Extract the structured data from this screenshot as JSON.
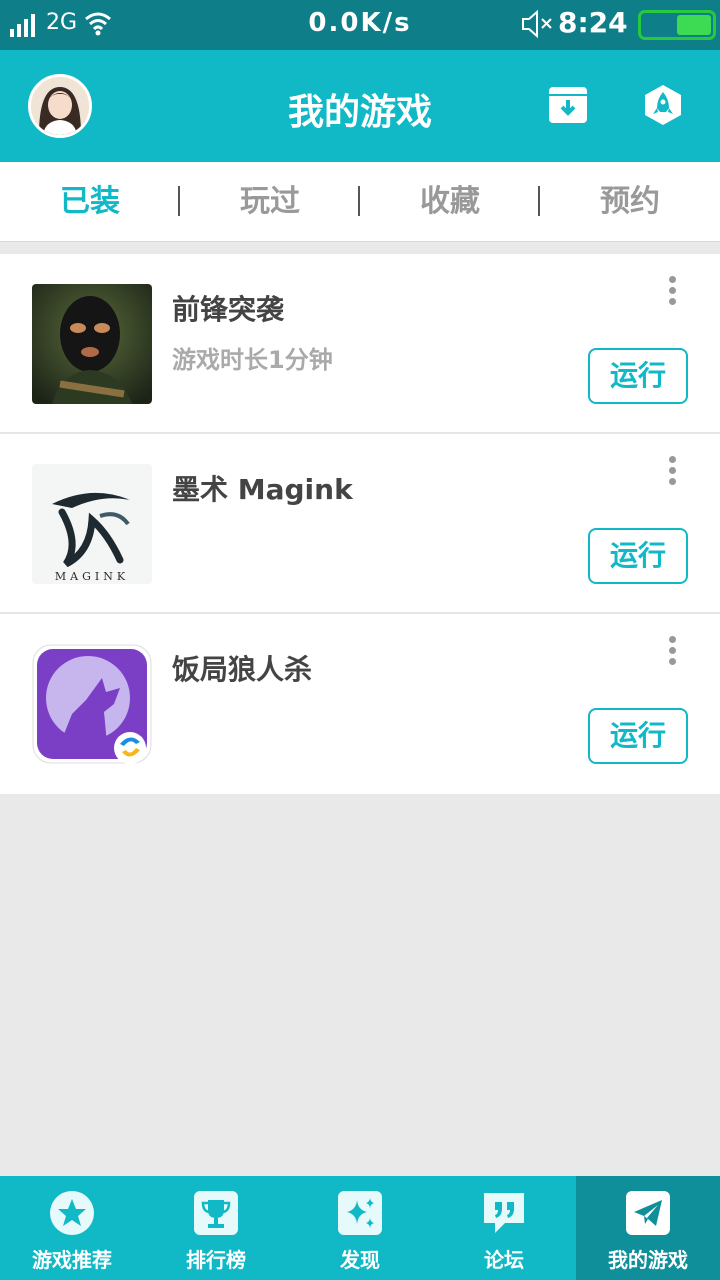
{
  "status_bar": {
    "network": "2G",
    "speed": "0.0K/s",
    "time": "8:24",
    "battery_level": 0.5
  },
  "header": {
    "title": "我的游戏"
  },
  "tabs": [
    {
      "label": "已装",
      "active": true
    },
    {
      "label": "玩过",
      "active": false
    },
    {
      "label": "收藏",
      "active": false
    },
    {
      "label": "预约",
      "active": false
    }
  ],
  "games": [
    {
      "name": "前锋突袭",
      "meta": "游戏时长1分钟",
      "action": "运行",
      "icon": "masked-soldier-icon"
    },
    {
      "name": "墨术 Magink",
      "meta": "",
      "action": "运行",
      "icon": "magink-ink-icon"
    },
    {
      "name": "饭局狼人杀",
      "meta": "",
      "action": "运行",
      "icon": "werewolf-icon"
    }
  ],
  "bottom_nav": [
    {
      "label": "游戏推荐",
      "icon": "star-icon",
      "active": false
    },
    {
      "label": "排行榜",
      "icon": "trophy-icon",
      "active": false
    },
    {
      "label": "发现",
      "icon": "sparkle-icon",
      "active": false
    },
    {
      "label": "论坛",
      "icon": "quote-icon",
      "active": false
    },
    {
      "label": "我的游戏",
      "icon": "paper-plane-icon",
      "active": true
    }
  ],
  "colors": {
    "accent": "#11b8c6",
    "status_bar": "#0e7f89",
    "battery": "#3ddb54"
  }
}
